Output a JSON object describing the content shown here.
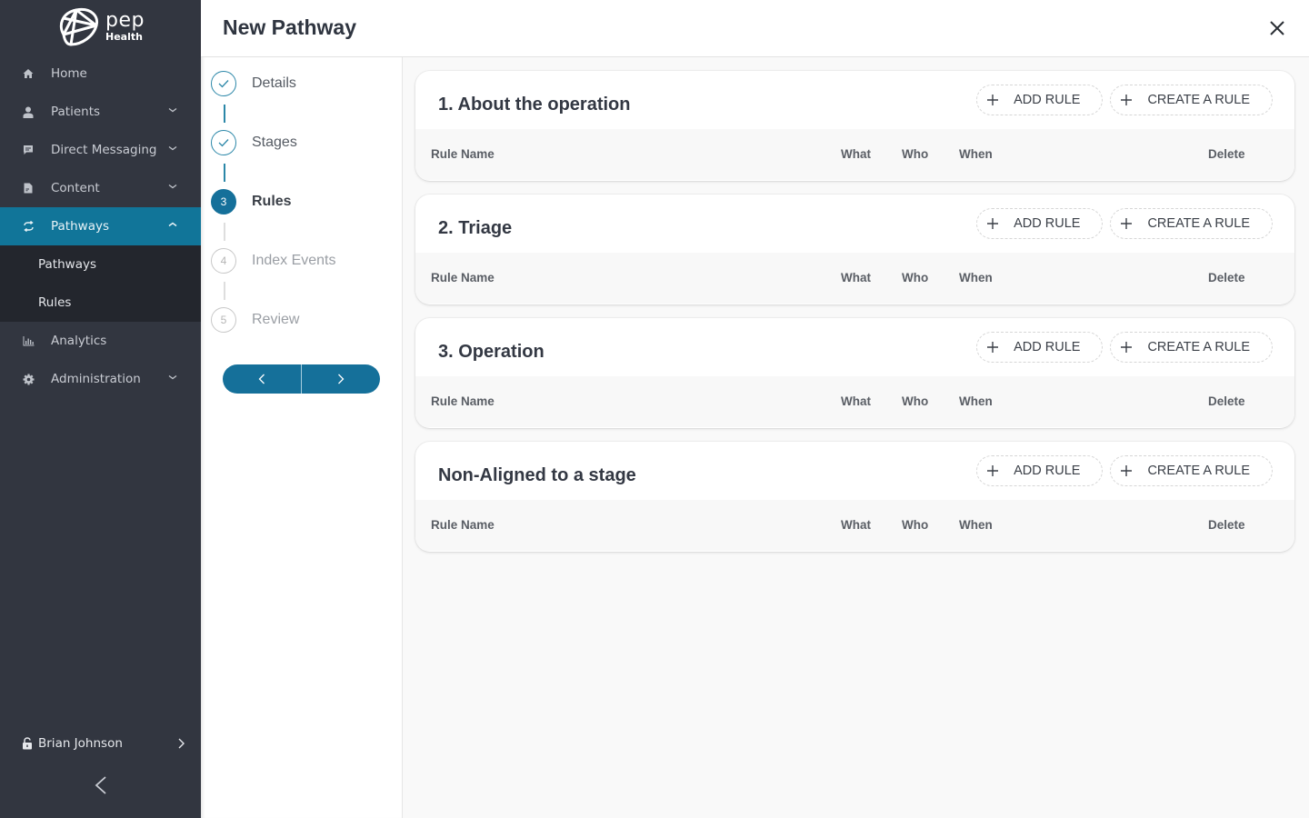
{
  "brand": {
    "name": "pep",
    "sub": "Health"
  },
  "sidebar": {
    "items": [
      {
        "label": "Home",
        "icon": "home-icon",
        "has_chevron": false
      },
      {
        "label": "Patients",
        "icon": "user-icon",
        "has_chevron": true
      },
      {
        "label": "Direct Messaging",
        "icon": "message-icon",
        "has_chevron": true
      },
      {
        "label": "Content",
        "icon": "document-icon",
        "has_chevron": true
      },
      {
        "label": "Pathways",
        "icon": "sync-icon",
        "has_chevron": true,
        "active": true,
        "expanded": true
      },
      {
        "label": "Analytics",
        "icon": "bar-chart-icon",
        "has_chevron": false
      },
      {
        "label": "Administration",
        "icon": "gear-icon",
        "has_chevron": true
      }
    ],
    "subitems": [
      {
        "label": "Pathways"
      },
      {
        "label": "Rules"
      }
    ],
    "user": {
      "name": "Brian Johnson",
      "icon": "lock-icon"
    },
    "collapse_icon": "chevron-left-icon"
  },
  "header": {
    "title": "New Pathway",
    "close_icon": "close-icon"
  },
  "stepper": {
    "steps": [
      {
        "number": "1",
        "label": "Details",
        "state": "done"
      },
      {
        "number": "2",
        "label": "Stages",
        "state": "done"
      },
      {
        "number": "3",
        "label": "Rules",
        "state": "current"
      },
      {
        "number": "4",
        "label": "Index Events",
        "state": "todo"
      },
      {
        "number": "5",
        "label": "Review",
        "state": "todo"
      }
    ],
    "prev_icon": "chevron-left-icon",
    "next_icon": "chevron-right-icon"
  },
  "sections": [
    {
      "title": "1. About the operation"
    },
    {
      "title": "2. Triage"
    },
    {
      "title": "3. Operation"
    },
    {
      "title": "Non-Aligned to a stage"
    }
  ],
  "section_actions": {
    "add_rule": "ADD RULE",
    "create_rule": "CREATE A RULE"
  },
  "table_columns": {
    "rule_name": "Rule Name",
    "what": "What",
    "who": "Who",
    "when": "When",
    "delete": "Delete"
  },
  "colors": {
    "sidebar_bg": "#323640",
    "sidebar_active": "#117599",
    "subnav_bg": "#23262d",
    "accent": "#15709a"
  }
}
